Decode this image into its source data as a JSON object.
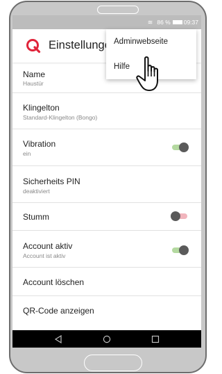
{
  "status_bar": {
    "battery": "86 %",
    "time": "09:37",
    "wifi_icon": "wifi-icon",
    "battery_icon": "battery-icon"
  },
  "app_bar": {
    "title": "Einstellungen",
    "logo_icon": "q-logo-icon"
  },
  "overflow_menu": {
    "items": [
      {
        "label": "Adminwebseite"
      },
      {
        "label": "Hilfe"
      }
    ]
  },
  "settings": [
    {
      "label": "Name",
      "sub": "Haustür"
    },
    {
      "label": "Klingelton",
      "sub": "Standard-Klingelton (Bongo)"
    },
    {
      "label": "Vibration",
      "sub": "ein",
      "toggle": true
    },
    {
      "label": "Sicherheits PIN",
      "sub": "deaktiviert"
    },
    {
      "label": "Stumm",
      "toggle": false
    },
    {
      "label": "Account aktiv",
      "sub": "Account ist aktiv",
      "toggle": true
    },
    {
      "label": "Account löschen"
    },
    {
      "label": "QR-Code anzeigen"
    }
  ],
  "nav_bar": {
    "icons": [
      "back-icon",
      "home-icon",
      "recents-icon"
    ]
  },
  "colors": {
    "accent": "#e0243a",
    "toggle_on_track": "#b4d9a0",
    "toggle_off_track": "#f1b5bd",
    "thumb": "#5a5a5a"
  }
}
